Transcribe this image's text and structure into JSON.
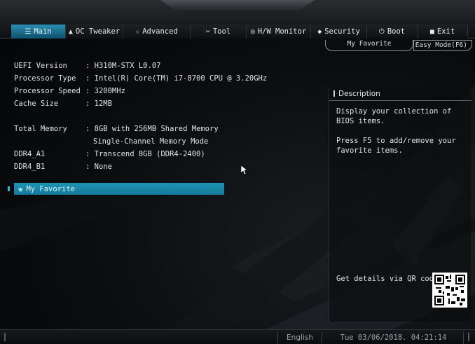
{
  "tabs": [
    {
      "label": "Main",
      "icon": "list-icon",
      "active": true
    },
    {
      "label": "OC Tweaker",
      "icon": "rocket-icon",
      "active": false
    },
    {
      "label": "Advanced",
      "icon": "star-outline-icon",
      "active": false
    },
    {
      "label": "Tool",
      "icon": "wrench-icon",
      "active": false
    },
    {
      "label": "H/W Monitor",
      "icon": "monitor-icon",
      "active": false
    },
    {
      "label": "Security",
      "icon": "shield-icon",
      "active": false
    },
    {
      "label": "Boot",
      "icon": "power-icon",
      "active": false
    },
    {
      "label": "Exit",
      "icon": "exit-icon",
      "active": false
    }
  ],
  "header": {
    "my_favorite": "My Favorite",
    "easy_mode": "Easy Mode(F6)"
  },
  "info": {
    "uefi_version": {
      "label": "UEFI Version",
      "value": ": H310M-STX L0.07"
    },
    "processor_type": {
      "label": "Processor Type",
      "value": ": Intel(R) Core(TM) i7-8700 CPU @ 3.20GHz"
    },
    "processor_speed": {
      "label": "Processor Speed",
      "value": ": 3200MHz"
    },
    "cache_size": {
      "label": "Cache Size",
      "value": ": 12MB"
    },
    "total_memory": {
      "label": "Total Memory",
      "value": ": 8GB with 256MB Shared Memory",
      "value2": "Single-Channel Memory Mode"
    },
    "ddr4_a1": {
      "label": "DDR4_A1",
      "value": ": Transcend 8GB (DDR4-2400)"
    },
    "ddr4_b1": {
      "label": "DDR4_B1",
      "value": ": None"
    }
  },
  "favorite_item": "My Favorite",
  "description": {
    "title": "Description",
    "line1": "Display your collection of BIOS items.",
    "line2": "Press F5 to add/remove your favorite items.",
    "qr_label": "Get details via QR code"
  },
  "footer": {
    "language": "English",
    "datetime": "Tue 03/06/2018. 04:21:14"
  },
  "colors": {
    "accent": "#1f93b5",
    "background": "#050607"
  }
}
